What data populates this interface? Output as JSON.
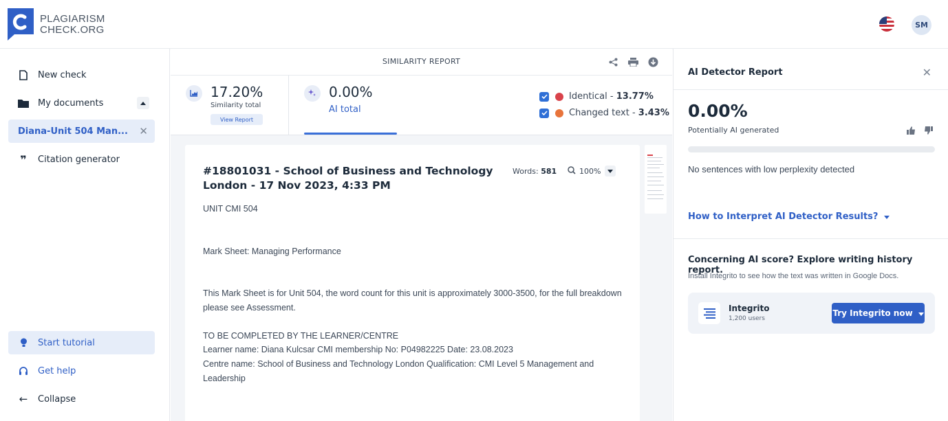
{
  "header": {
    "logo_line1": "PLAGIARISM",
    "logo_line2": "CHECK.ORG",
    "avatar_initials": "SM",
    "language_flag": "us-flag-icon"
  },
  "sidebar": {
    "new_check": "New check",
    "my_documents": "My documents",
    "active_document": "Diana-Unit 504 Man...",
    "citation_generator": "Citation generator",
    "start_tutorial": "Start tutorial",
    "get_help": "Get help",
    "collapse": "Collapse"
  },
  "report": {
    "title": "SIMILARITY REPORT",
    "similarity_pct": "17.20%",
    "similarity_label": "Similarity total",
    "view_report": "View Report",
    "ai_pct": "0.00%",
    "ai_label": "AI total",
    "identical_label": "Identical - ",
    "identical_value": "13.77%",
    "changed_label": "Changed text - ",
    "changed_value": "3.43%",
    "colors": {
      "identical": "#d9434b",
      "changed": "#e8743b",
      "accent": "#2f5fc6"
    }
  },
  "document": {
    "title": "#18801031 - School of Business and Technology London - 17 Nov 2023, 4:33 PM",
    "words_label": "Words: ",
    "words_value": "581",
    "zoom": "100%",
    "paragraphs": [
      "UNIT CMI 504",
      "Mark Sheet: Managing Performance",
      "This Mark Sheet is for Unit 504, the word count for this unit is approximately 3000-3500, for the full breakdown please see Assessment.",
      "TO BE COMPLETED BY THE LEARNER/CENTRE",
      "Learner name: Diana Kulcsar CMI membership No: P04982225 Date: 23.08.2023",
      "Centre name: School of Business and Technology London Qualification: CMI Level 5 Management and Leadership"
    ]
  },
  "ai_panel": {
    "title": "AI Detector Report",
    "percent": "0.00%",
    "sub": "Potentially AI generated",
    "ai_fraction": 0.0,
    "no_sentences": "No sentences with low perplexity detected",
    "how_to": "How to Interpret AI Detector Results?",
    "concern": "Concerning AI score? Explore writing history report.",
    "install": "Install Integrito to see how the text was written in Google Docs.",
    "promo_name": "Integrito",
    "promo_users": "1,200 users",
    "try_button": "Try Integrito now"
  }
}
